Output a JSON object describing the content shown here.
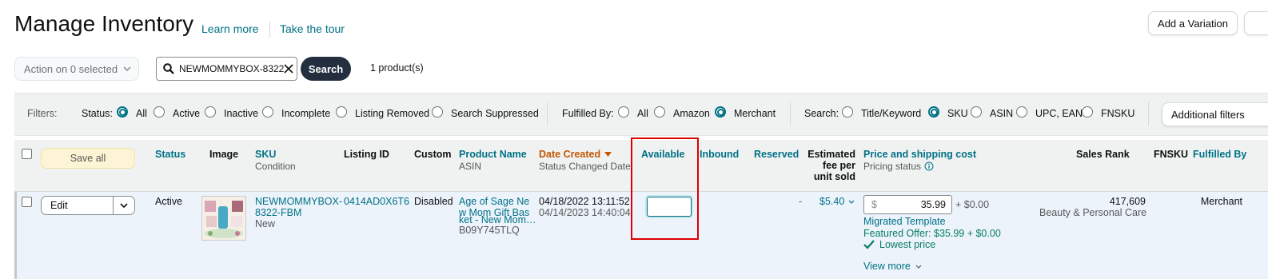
{
  "header": {
    "title": "Manage Inventory",
    "learn_more": "Learn more",
    "take_tour": "Take the tour",
    "add_variation": "Add a Variation"
  },
  "toolbar": {
    "action_label": "Action on 0 selected",
    "search_value": "NEWMOMMYBOX-8322",
    "search_button": "Search",
    "product_count": "1 product(s)"
  },
  "filters": {
    "label": "Filters:",
    "status_label": "Status:",
    "status_options": [
      "All",
      "Active",
      "Inactive",
      "Incomplete",
      "Listing Removed",
      "Search Suppressed"
    ],
    "status_selected": "All",
    "fulfilled_label": "Fulfilled By:",
    "fulfilled_options": [
      "All",
      "Amazon",
      "Merchant"
    ],
    "fulfilled_selected": "Merchant",
    "search_label": "Search:",
    "search_options": [
      "Title/Keyword",
      "SKU",
      "ASIN",
      "UPC, EAN",
      "FNSKU"
    ],
    "search_selected": "SKU",
    "additional": "Additional filters"
  },
  "columns": {
    "save_all": "Save all",
    "status": "Status",
    "image": "Image",
    "sku": "SKU",
    "sku_sub": "Condition",
    "listing_id": "Listing ID",
    "custom": "Custom",
    "product_name": "Product Name",
    "product_sub": "ASIN",
    "date_created": "Date Created",
    "date_sub": "Status Changed Date",
    "available": "Available",
    "inbound": "Inbound",
    "reserved": "Reserved",
    "est_fee_1": "Estimated",
    "est_fee_2": "fee per",
    "est_fee_3": "unit sold",
    "price": "Price and shipping cost",
    "price_sub": "Pricing status",
    "sales_rank": "Sales Rank",
    "fnsku": "FNSKU",
    "fulfilled_by": "Fulfilled By"
  },
  "row": {
    "edit": "Edit",
    "status": "Active",
    "sku_1": "NEWMOMMYBOX-",
    "sku_2": "8322-FBM",
    "condition": "New",
    "listing_id": "0414AD0X6T6",
    "custom": "Disabled",
    "name_1": "Age of Sage Ne",
    "name_2": "w Mom Gift Bas",
    "name_3": "ket - New Mom…",
    "asin": "B09Y745TLQ",
    "date_created": "04/18/2022 13:11:52",
    "status_changed": "04/14/2023 14:40:04",
    "available_value": "",
    "reserved": "-",
    "fee": "$5.40",
    "price_symbol": "$",
    "price": "35.99",
    "shipping": "+ $0.00",
    "migrated": "Migrated Template",
    "featured": "Featured Offer: $35.99 + $0.00",
    "lowest": "Lowest price",
    "view_more": "View more",
    "sales_rank": "417,609",
    "rank_category": "Beauty & Personal Care",
    "fulfilled_by": "Merchant"
  },
  "colors": {
    "teal": "#007185",
    "orange": "#c45500",
    "highlight": "#e00000",
    "green_check": "#067d62"
  }
}
